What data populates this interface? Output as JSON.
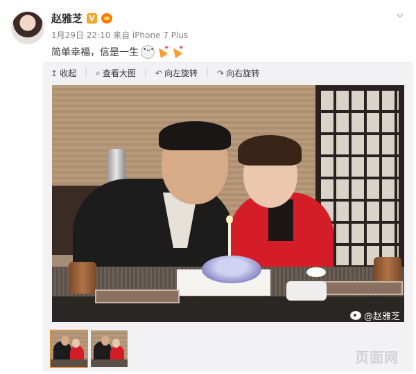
{
  "post": {
    "username": "赵雅芝",
    "verified_badge": "V",
    "meta": "1月29日 22:10 来自 iPhone 7 Plus",
    "text": "简单幸福，信是一生",
    "emojis": [
      "doge-emoji-icon",
      "party-popper-icon",
      "party-popper-icon"
    ]
  },
  "toolbar": {
    "collapse": "收起",
    "view_large": "查看大图",
    "rotate_left": "向左旋转",
    "rotate_right": "向右旋转",
    "icons": {
      "collapse": "↥",
      "view_large": "⌕",
      "rotate_left": "↶",
      "rotate_right": "↷"
    }
  },
  "photo": {
    "watermark": "@赵雅芝"
  },
  "thumbnails": [
    {
      "active": true
    },
    {
      "active": false
    }
  ],
  "site_mark": "页面网",
  "colors": {
    "accent_orange": "#f08c2e",
    "verified_yellow": "#f5a623",
    "meta_gray": "#808080",
    "panel_bg": "#f2f2f5"
  }
}
